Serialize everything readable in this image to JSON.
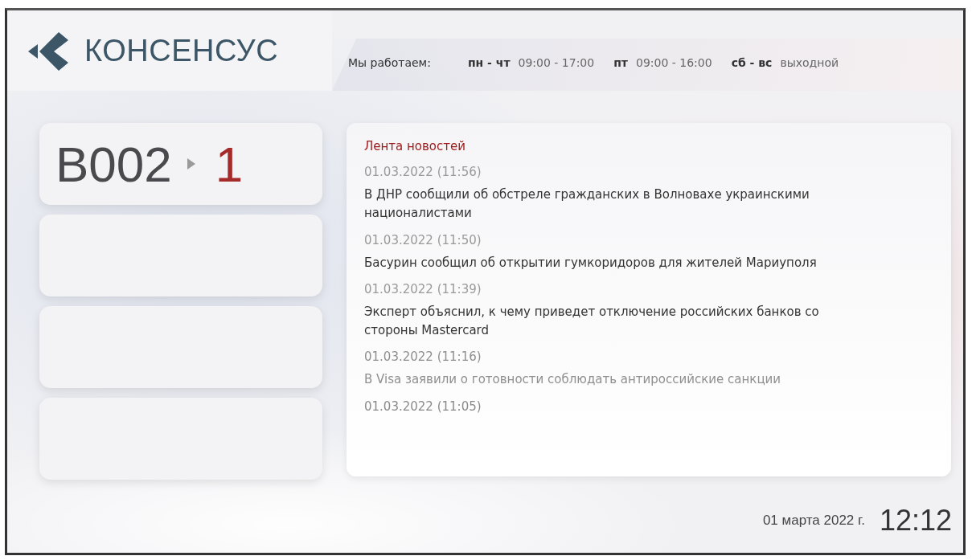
{
  "logo": {
    "text": "КОНСЕНСУС"
  },
  "schedule": {
    "label": "Мы работаем:",
    "entries": [
      {
        "days": "пн - чт",
        "hours": "09:00 - 17:00"
      },
      {
        "days": "пт",
        "hours": "09:00 - 16:00"
      },
      {
        "days": "сб - вс",
        "hours": "выходной"
      }
    ]
  },
  "tickets": [
    {
      "kind": "ticket",
      "code": "B002",
      "window": "1"
    },
    {
      "kind": "empty"
    },
    {
      "kind": "empty"
    },
    {
      "kind": "empty"
    }
  ],
  "news": {
    "title": "Лента новостей",
    "items": [
      {
        "kind": "normal",
        "date": "01.03.2022 (11:56)",
        "text": "В ДНР сообщили об обстреле гражданских в Волновахе украинскими националистами"
      },
      {
        "kind": "normal",
        "date": "01.03.2022 (11:50)",
        "text": "Басурин сообщил об открытии гумкоридоров для жителей Мариуполя"
      },
      {
        "kind": "normal",
        "date": "01.03.2022 (11:39)",
        "text": "Эксперт объяснил, к чему приведет отключение российских банков со стороны Mastercard"
      },
      {
        "kind": "faded",
        "date": "01.03.2022 (11:16)",
        "text": "В Visa заявили о готовности соблюдать антироссийские санкции"
      },
      {
        "kind": "ghost",
        "date": "01.03.2022 (11:05)"
      }
    ]
  },
  "footer": {
    "date": "01 марта 2022 г.",
    "time": "12:12"
  }
}
